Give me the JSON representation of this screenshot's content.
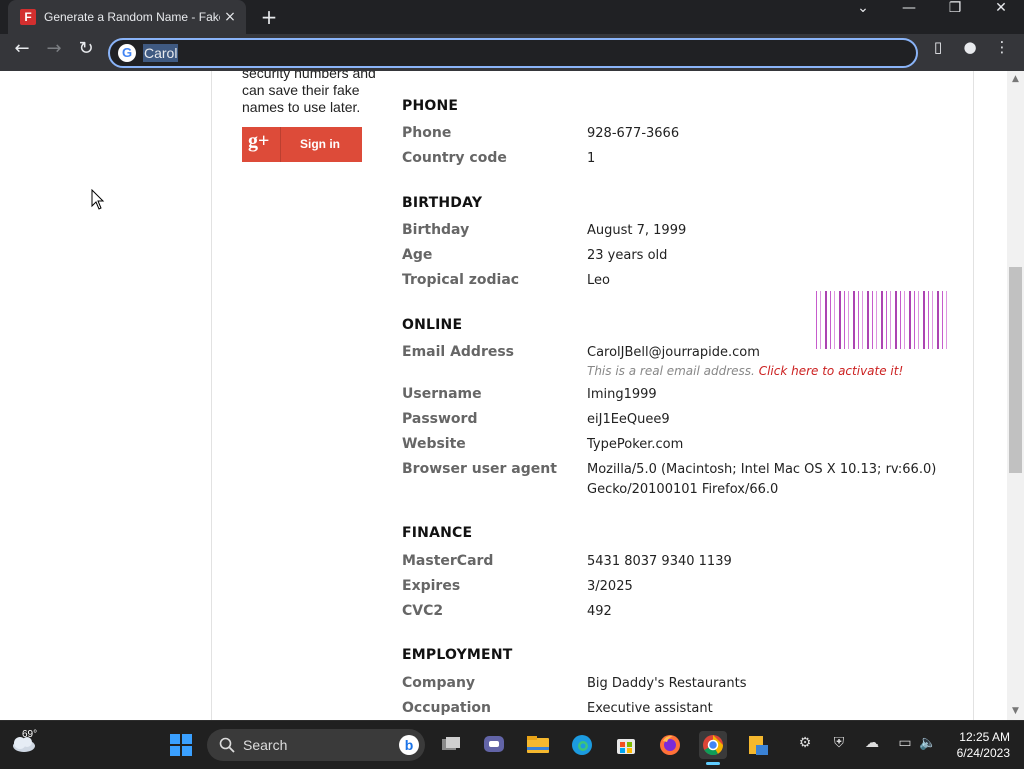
{
  "browser": {
    "tab_title": "Generate a Random Name - Fake",
    "tab_favicon": "F",
    "tab_close": "×",
    "new_tab": "+",
    "window_controls": {
      "minimize": "—",
      "maximize": "❐",
      "close": "✕",
      "tab_search": "⌄"
    },
    "address_value": "Carol",
    "search_engine_icon": "G",
    "nav": {
      "back": "←",
      "forward": "→",
      "reload": "↻"
    },
    "toolbar_icons": {
      "sidebar": "▯",
      "profile": "●",
      "menu": "⋮"
    }
  },
  "page": {
    "sidebar_blurb": "security numbers and can save their fake names to use later.",
    "google_signin": {
      "logo": "g+",
      "label": "Sign in",
      "color": "#dd4b39"
    },
    "sections": {
      "phone": {
        "heading": "PHONE",
        "rows": [
          {
            "label": "Phone",
            "value": "928-677-3666"
          },
          {
            "label": "Country code",
            "value": "1"
          }
        ]
      },
      "birthday": {
        "heading": "BIRTHDAY",
        "rows": [
          {
            "label": "Birthday",
            "value": "August 7, 1999"
          },
          {
            "label": "Age",
            "value": "23 years old"
          },
          {
            "label": "Tropical zodiac",
            "value": "Leo"
          }
        ]
      },
      "online": {
        "heading": "ONLINE",
        "email": {
          "label": "Email Address",
          "value": "CarolJBell@jourrapide.com",
          "note": "This is a real email address.",
          "note_link": "Click here to activate it!"
        },
        "rows": [
          {
            "label": "Username",
            "value": "Iming1999"
          },
          {
            "label": "Password",
            "value": "eiJ1EeQuee9"
          },
          {
            "label": "Website",
            "value": "TypePoker.com"
          }
        ],
        "user_agent": {
          "label": "Browser user agent",
          "line1": "Mozilla/5.0 (Macintosh; Intel Mac OS X 10.13; rv:66.0)",
          "line2": "Gecko/20100101 Firefox/66.0"
        }
      },
      "finance": {
        "heading": "FINANCE",
        "rows": [
          {
            "label": "MasterCard",
            "value": "5431 8037 9340 1139"
          },
          {
            "label": "Expires",
            "value": "3/2025"
          },
          {
            "label": "CVC2",
            "value": "492"
          }
        ]
      },
      "employment": {
        "heading": "EMPLOYMENT",
        "rows": [
          {
            "label": "Company",
            "value": "Big Daddy's Restaurants"
          },
          {
            "label": "Occupation",
            "value": "Executive assistant"
          }
        ]
      }
    }
  },
  "scrollbar": {
    "up": "▲",
    "down": "▼"
  },
  "taskbar": {
    "weather_temp": "69°",
    "search_label": "Search",
    "bing_icon": "b",
    "clock_time": "12:25 AM",
    "clock_date": "6/24/2023",
    "accent": "#60cdff",
    "apps": [
      "task-view",
      "teams",
      "file-explorer",
      "edge",
      "store",
      "firefox",
      "chrome",
      "file-manager"
    ],
    "tray_icons": [
      "steam-icon",
      "shield-icon",
      "drive-icon",
      "display-icon",
      "volume-icon"
    ]
  }
}
